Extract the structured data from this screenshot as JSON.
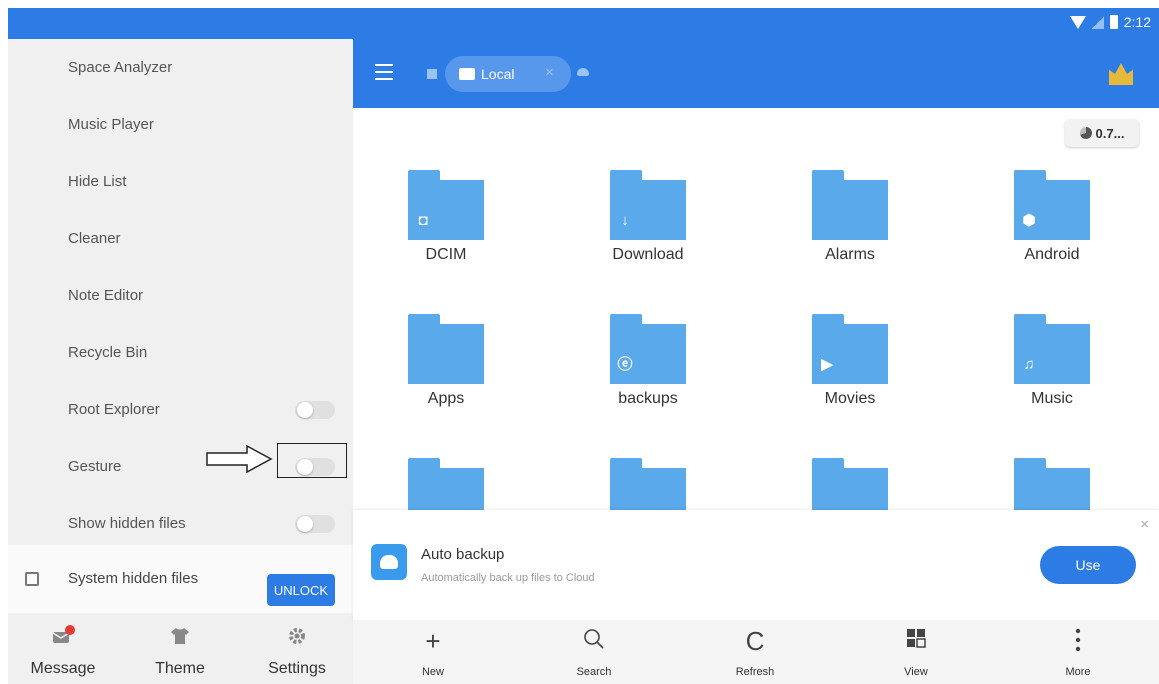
{
  "status_bar": {
    "time": "2:12"
  },
  "sidebar": {
    "items": [
      {
        "label": "Space Analyzer"
      },
      {
        "label": "Music Player"
      },
      {
        "label": "Hide List"
      },
      {
        "label": "Cleaner"
      },
      {
        "label": "Note Editor"
      },
      {
        "label": "Recycle Bin"
      },
      {
        "label": "Root Explorer",
        "toggle": "off"
      },
      {
        "label": "Gesture",
        "toggle": "off"
      },
      {
        "label": "Show hidden files",
        "toggle": "off"
      }
    ],
    "system_hidden": {
      "label": "System hidden files",
      "button": "UNLOCK"
    },
    "bottom": [
      {
        "label": "Message",
        "icon": "message-icon",
        "badge_color": "#e53935"
      },
      {
        "label": "Theme",
        "icon": "shirt-icon"
      },
      {
        "label": "Settings",
        "icon": "gear-icon"
      }
    ]
  },
  "topbar": {
    "chip_label": "Local",
    "chip_close": "×"
  },
  "storage_badge": "0.7...",
  "folders": [
    {
      "name": "DCIM",
      "emblem": "camera-icon"
    },
    {
      "name": "Download",
      "emblem": "download-icon"
    },
    {
      "name": "Alarms",
      "emblem": ""
    },
    {
      "name": "Android",
      "emblem": "android-gear-icon"
    },
    {
      "name": "Apps",
      "emblem": ""
    },
    {
      "name": "backups",
      "emblem": "es-icon"
    },
    {
      "name": "Movies",
      "emblem": "play-icon"
    },
    {
      "name": "Music",
      "emblem": "music-note-icon"
    }
  ],
  "backup_banner": {
    "title": "Auto backup",
    "subtitle": "Automatically back up files to Cloud",
    "button": "Use",
    "close": "×"
  },
  "toolbar": [
    {
      "label": "New",
      "icon": "plus-icon"
    },
    {
      "label": "Search",
      "icon": "search-icon"
    },
    {
      "label": "Refresh",
      "icon": "refresh-icon"
    },
    {
      "label": "View",
      "icon": "grid-view-icon"
    },
    {
      "label": "More",
      "icon": "more-vert-icon"
    }
  ],
  "colors": {
    "accent": "#2d7ce6",
    "folder": "#5aa9ea",
    "sidebar_bg": "#f0f0f0"
  }
}
